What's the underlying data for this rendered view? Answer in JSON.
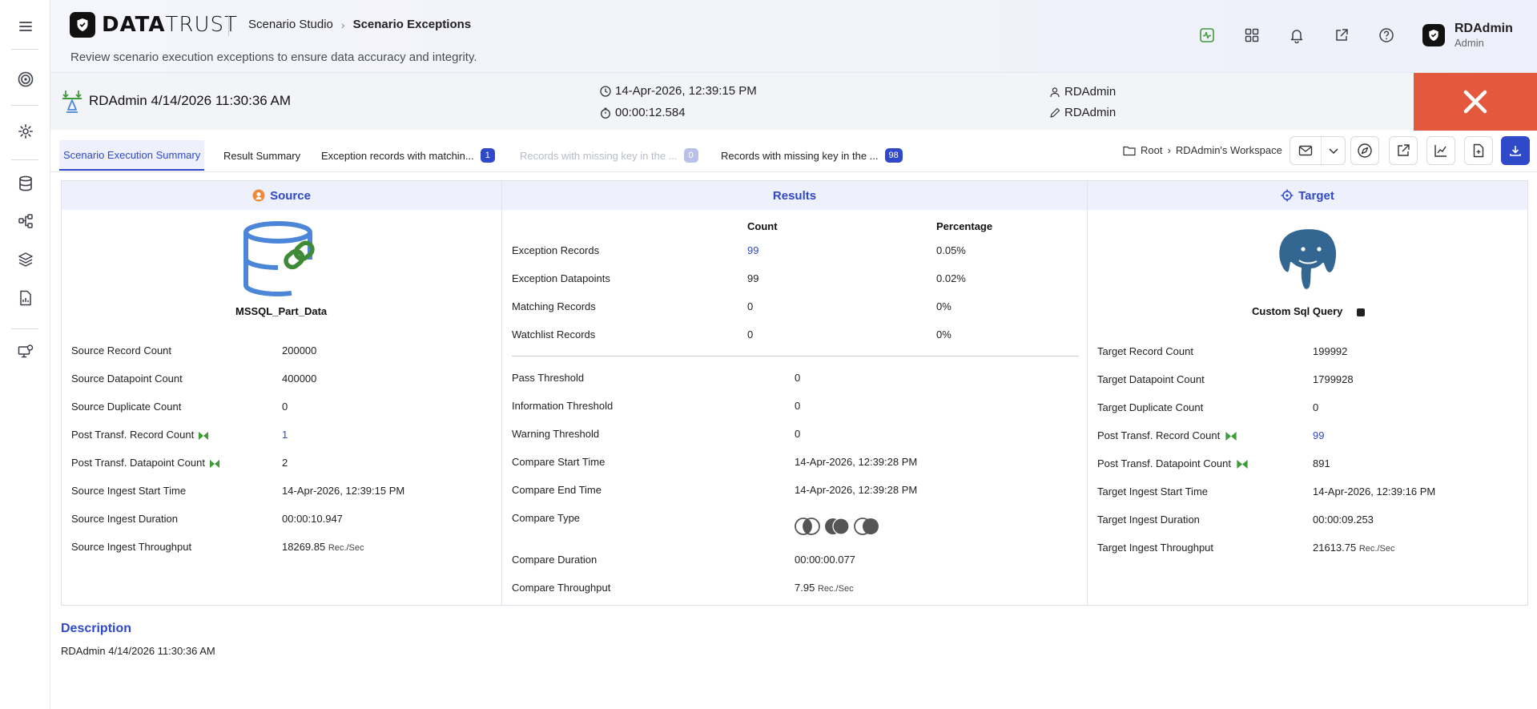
{
  "brand": {
    "word_bold": "DATA",
    "word_light": "TRUST"
  },
  "breadcrumb": {
    "parent": "Scenario Studio",
    "current": "Scenario Exceptions"
  },
  "subtitle": "Review scenario execution exceptions to ensure data accuracy and integrity.",
  "user": {
    "name": "RDAdmin",
    "role": "Admin"
  },
  "scenario": {
    "name": "RDAdmin 4/14/2026 11:30:36 AM",
    "run_time": "14-Apr-2026, 12:39:15 PM",
    "duration": "00:00:12.584",
    "created_by": "RDAdmin",
    "modified_by": "RDAdmin"
  },
  "tabs": [
    {
      "label": "Scenario Execution Summary",
      "active": true
    },
    {
      "label": "Result Summary"
    },
    {
      "label": "Exception records with matchin...",
      "badge": "1"
    },
    {
      "label": "Records with missing key in the ...",
      "badge": "0",
      "disabled": true
    },
    {
      "label": "Records with missing key in the ...",
      "badge": "98"
    }
  ],
  "path": {
    "root": "Root",
    "workspace": "RDAdmin's Workspace"
  },
  "source": {
    "heading": "Source",
    "dataset": "MSSQL_Part_Data",
    "rows": [
      {
        "label": "Source Record Count",
        "value": "200000"
      },
      {
        "label": "Source Datapoint Count",
        "value": "400000"
      },
      {
        "label": "Source Duplicate Count",
        "value": "0"
      },
      {
        "label": "Post Transf. Record Count",
        "value": "1"
      },
      {
        "label": "Post Transf. Datapoint Count",
        "value": "2"
      },
      {
        "label": "Source Ingest Start Time",
        "value": "14-Apr-2026, 12:39:15 PM"
      },
      {
        "label": "Source Ingest Duration",
        "value": "00:00:10.947"
      },
      {
        "label": "Source Ingest Throughput",
        "value": "18269.85",
        "unit": "Rec./Sec"
      }
    ]
  },
  "results": {
    "heading": "Results",
    "col_count": "Count",
    "col_pct": "Percentage",
    "metrics": [
      {
        "label": "Exception Records",
        "count": "99",
        "pct": "0.05%"
      },
      {
        "label": "Exception Datapoints",
        "count": "99",
        "pct": "0.02%"
      },
      {
        "label": "Matching Records",
        "count": "0",
        "pct": "0%"
      },
      {
        "label": "Watchlist Records",
        "count": "0",
        "pct": "0%"
      }
    ],
    "details": [
      {
        "label": "Pass Threshold",
        "value": "0"
      },
      {
        "label": "Information Threshold",
        "value": "0"
      },
      {
        "label": "Warning Threshold",
        "value": "0"
      },
      {
        "label": "Compare Start Time",
        "value": "14-Apr-2026, 12:39:28 PM"
      },
      {
        "label": "Compare End Time",
        "value": "14-Apr-2026, 12:39:28 PM"
      },
      {
        "label": "Compare Type",
        "value": ""
      },
      {
        "label": "Compare Duration",
        "value": "00:00:00.077"
      },
      {
        "label": "Compare Throughput",
        "value": "7.95",
        "unit": "Rec./Sec"
      }
    ]
  },
  "target": {
    "heading": "Target",
    "dataset": "Custom Sql Query",
    "rows": [
      {
        "label": "Target Record Count",
        "value": "199992"
      },
      {
        "label": "Target Datapoint Count",
        "value": "1799928"
      },
      {
        "label": "Target Duplicate Count",
        "value": "0"
      },
      {
        "label": "Post Transf. Record Count",
        "value": "99"
      },
      {
        "label": "Post Transf. Datapoint Count",
        "value": "891"
      },
      {
        "label": "Target Ingest Start Time",
        "value": "14-Apr-2026, 12:39:16 PM"
      },
      {
        "label": "Target Ingest Duration",
        "value": "00:00:09.253"
      },
      {
        "label": "Target Ingest Throughput",
        "value": "21613.75",
        "unit": "Rec./Sec"
      }
    ]
  },
  "description": {
    "title": "Description",
    "text": "RDAdmin 4/14/2026 11:30:36 AM"
  },
  "colors": {
    "accent": "#2f49c8",
    "close": "#e4593d",
    "green": "#3f9a3a",
    "db_blue": "#4b86d8"
  }
}
